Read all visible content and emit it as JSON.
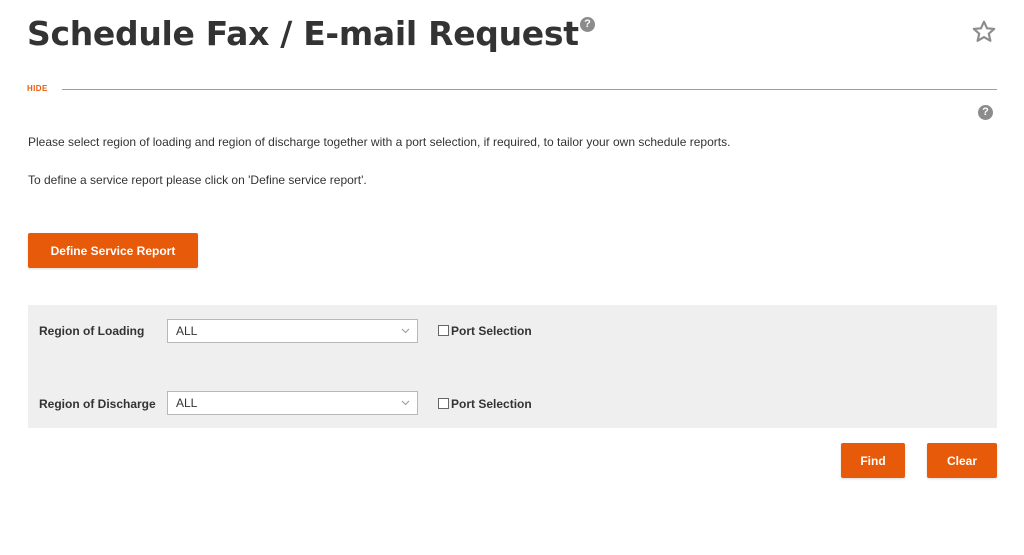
{
  "header": {
    "title": "Schedule Fax / E-mail Request",
    "help_icon": "question-circle-icon",
    "favorite_icon": "star-outline-icon"
  },
  "section": {
    "hide_label": "HIDE",
    "help_icon": "question-circle-icon"
  },
  "intro": {
    "line1": "Please select region of loading and region of discharge together with a port selection, if required, to tailor your own schedule reports.",
    "line2": "To define a service report please click on 'Define service report'."
  },
  "actions": {
    "define_label": "Define Service Report",
    "find_label": "Find",
    "clear_label": "Clear"
  },
  "filters": {
    "loading": {
      "label": "Region of Loading",
      "selected": "ALL",
      "port_selection_label": "Port Selection",
      "port_selection_checked": false
    },
    "discharge": {
      "label": "Region of Discharge",
      "selected": "ALL",
      "port_selection_label": "Port Selection",
      "port_selection_checked": false
    }
  },
  "colors": {
    "accent": "#e65a0a",
    "panel_bg": "#efefef",
    "text": "#333333"
  }
}
